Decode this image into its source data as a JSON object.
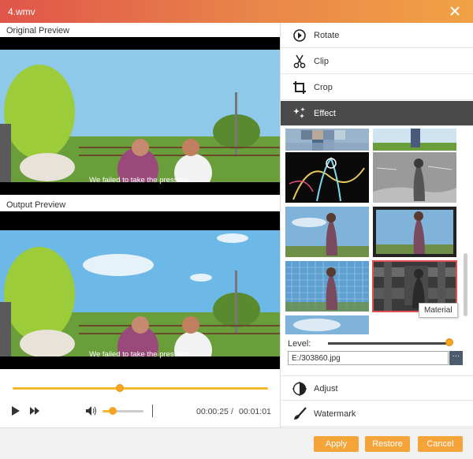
{
  "window": {
    "title": "4.wmv"
  },
  "preview": {
    "original_label": "Original Preview",
    "output_label": "Output Preview",
    "subtitle": "We failed to take the pressure."
  },
  "player": {
    "current_time": "00:00:25",
    "separator": "/",
    "total_time": "00:01:01",
    "seek_progress": 0.42,
    "volume_level": 0.25
  },
  "tools": [
    {
      "label": "Rotate",
      "icon": "rotate-icon"
    },
    {
      "label": "Clip",
      "icon": "scissors-icon"
    },
    {
      "label": "Crop",
      "icon": "crop-icon"
    },
    {
      "label": "Effect",
      "icon": "sparkle-icon",
      "active": true
    },
    {
      "label": "Adjust",
      "icon": "adjust-icon"
    },
    {
      "label": "Watermark",
      "icon": "brush-icon"
    }
  ],
  "effects": {
    "selected_tooltip": "Material",
    "level_label": "Level:",
    "level_value": 1.0,
    "material_path": "E:/303860.jpg",
    "browse_label": "···"
  },
  "buttons": {
    "apply": "Apply",
    "restore": "Restore",
    "cancel": "Cancel"
  },
  "colors": {
    "accent": "#f5a623",
    "active_tool": "#4a4a4a",
    "title_start": "#e0554a",
    "title_end": "#f0a244"
  }
}
